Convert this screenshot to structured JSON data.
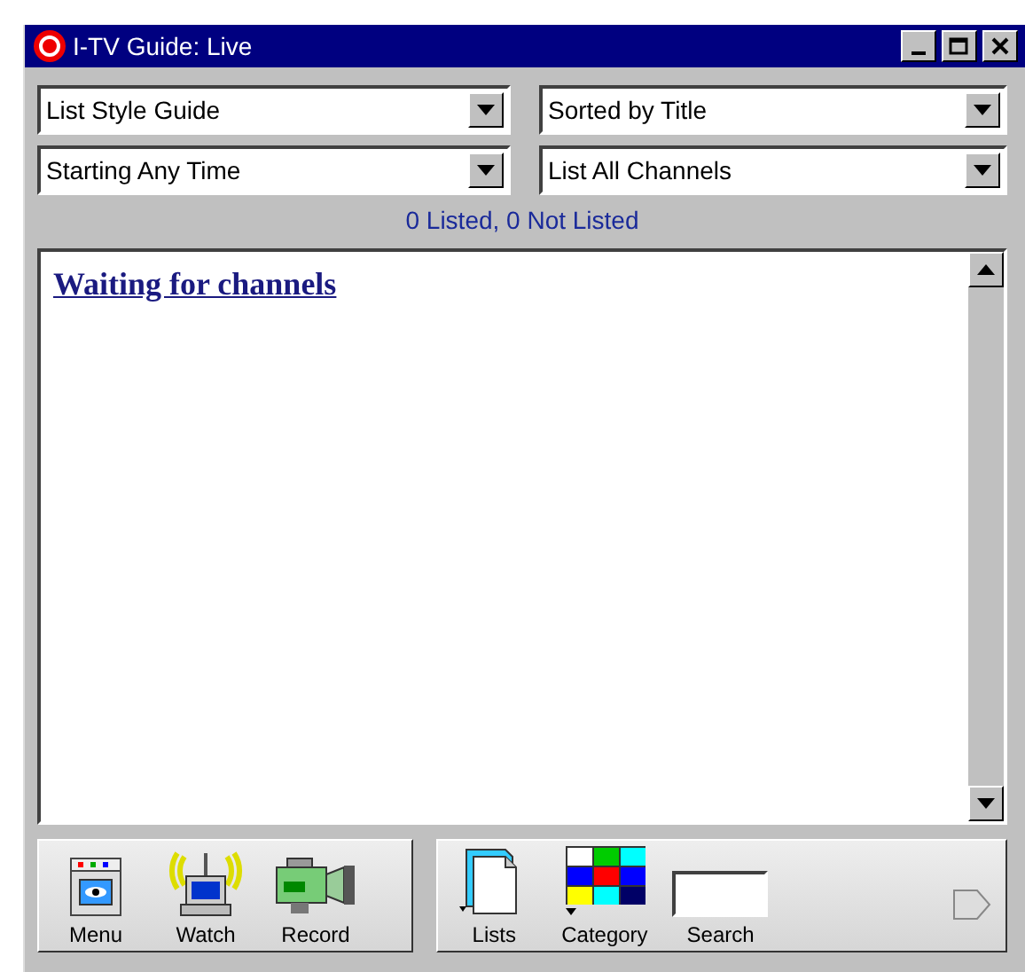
{
  "window": {
    "title": "I-TV Guide: Live"
  },
  "filters": [
    {
      "value": "List Style Guide"
    },
    {
      "value": "Sorted by Title"
    },
    {
      "value": "Starting Any Time"
    },
    {
      "value": "List All Channels"
    }
  ],
  "status": "0 Listed,  0 Not Listed",
  "listing": {
    "heading": "Waiting for channels"
  },
  "toolbar": {
    "left": [
      {
        "kind": "menu",
        "label": "Menu"
      },
      {
        "kind": "watch",
        "label": "Watch"
      },
      {
        "kind": "record",
        "label": "Record"
      }
    ],
    "right": [
      {
        "kind": "lists",
        "label": "Lists"
      },
      {
        "kind": "category",
        "label": "Category"
      },
      {
        "kind": "search",
        "label": "Search"
      }
    ]
  }
}
